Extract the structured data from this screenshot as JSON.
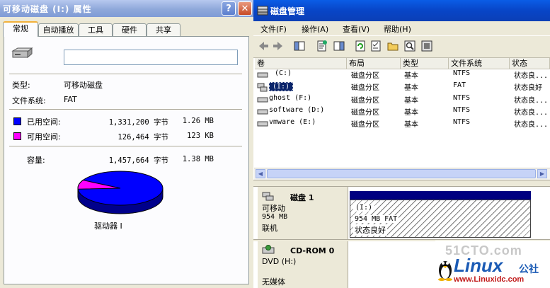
{
  "props": {
    "title": "可移动磁盘 (I:) 属性",
    "help_btn": "?",
    "close_btn": "✕",
    "tabs": [
      "常规",
      "自动播放",
      "工具",
      "硬件",
      "共享"
    ],
    "name_value": "",
    "type_label": "类型:",
    "type_value": "可移动磁盘",
    "fs_label": "文件系统:",
    "fs_value": "FAT",
    "used_label": "已用空间:",
    "used_bytes": "1,331,200 字节",
    "used_size": "1.26 MB",
    "free_label": "可用空间:",
    "free_bytes": "126,464 字节",
    "free_size": "123 KB",
    "cap_label": "容量:",
    "cap_bytes": "1,457,664 字节",
    "cap_size": "1.38 MB",
    "drive_label": "驱动器 I",
    "used_color": "#0000ff",
    "free_color": "#ff00ff",
    "used_fraction": 0.913
  },
  "dm": {
    "title": "磁盘管理",
    "menus": [
      "文件(F)",
      "操作(A)",
      "查看(V)",
      "帮助(H)"
    ],
    "columns": [
      "卷",
      "布局",
      "类型",
      "文件系统",
      "状态"
    ],
    "rows": [
      {
        "vol": "(C:)",
        "layout": "磁盘分区",
        "type": "基本",
        "fs": "NTFS",
        "status": "状态良..."
      },
      {
        "vol": "(I:)",
        "layout": "磁盘分区",
        "type": "基本",
        "fs": "FAT",
        "status": "状态良好"
      },
      {
        "vol": "ghost (F:)",
        "layout": "磁盘分区",
        "type": "基本",
        "fs": "NTFS",
        "status": "状态良..."
      },
      {
        "vol": "software (D:)",
        "layout": "磁盘分区",
        "type": "基本",
        "fs": "NTFS",
        "status": "状态良..."
      },
      {
        "vol": "vmware (E:)",
        "layout": "磁盘分区",
        "type": "基本",
        "fs": "NTFS",
        "status": "状态良..."
      }
    ],
    "disk1": {
      "name": "磁盘 1",
      "kind": "可移动",
      "size": "954 MB",
      "state": "联机",
      "part_name": "(I:)",
      "part_info": "954 MB FAT",
      "part_status": "状态良好"
    },
    "cdrom": {
      "name": "CD-ROM 0",
      "kind": "DVD (H:)",
      "media": "无媒体"
    }
  },
  "watermark": {
    "site1": "51CTO.com",
    "brand": "Linux",
    "brand_suffix": "公社",
    "url": "www.Linuxidc.com"
  }
}
